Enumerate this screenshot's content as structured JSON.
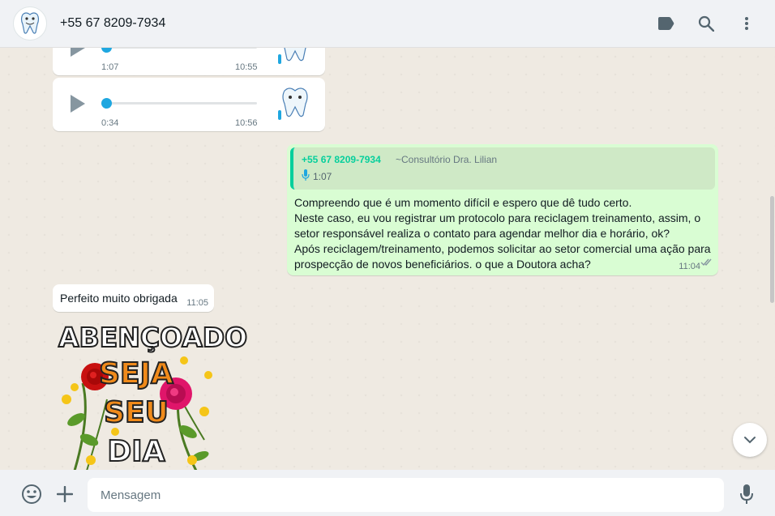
{
  "header": {
    "contact_name": "+55 67 8209-7934"
  },
  "messages": {
    "audio1": {
      "duration": "1:07",
      "time": "10:55"
    },
    "audio2": {
      "duration": "0:34",
      "time": "10:56"
    },
    "outgoing": {
      "quote_name": "+55 67 8209-7934",
      "quote_pushname": "~Consultório Dra. Lilian",
      "quote_duration": "1:07",
      "text": "Compreendo que é um momento difícil e espero que dê tudo certo.\nNeste caso, eu vou registrar um protocolo para reciclagem treinamento, assim, o setor responsável realiza o contato para agendar melhor dia e horário, ok?\nApós reciclagem/treinamento, podemos solicitar ao setor comercial uma ação para prospecção de novos beneficiários. o que a Doutora acha?",
      "time": "11:04"
    },
    "incoming_text": {
      "text": "Perfeito muito obrigada",
      "time": "11:05"
    },
    "sticker": {
      "line1": "ABENÇOADO",
      "line2": "SEJA",
      "line3": "SEU",
      "line4": "DIA"
    }
  },
  "footer": {
    "placeholder": "Mensagem"
  },
  "icons": {
    "label": "label-icon",
    "search": "search-icon",
    "menu": "menu-icon",
    "emoji": "emoji-icon",
    "attach": "plus-icon",
    "mic": "mic-icon",
    "scroll": "chevron-down-icon"
  },
  "colors": {
    "accent": "#06cf9c",
    "outgoing_bubble": "#d9fdd3",
    "audio_knob": "#1fa7e0"
  }
}
